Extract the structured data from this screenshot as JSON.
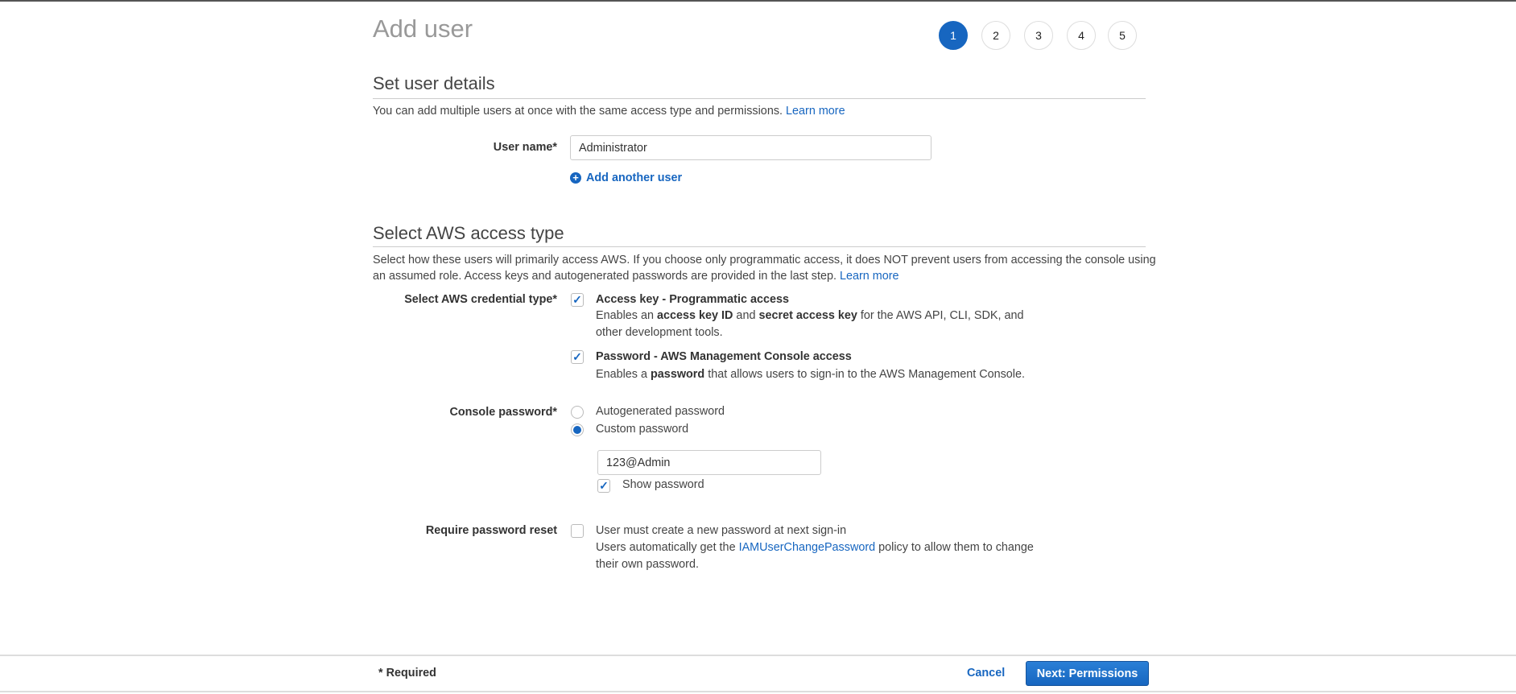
{
  "title": "Add user",
  "steps": [
    "1",
    "2",
    "3",
    "4",
    "5"
  ],
  "details": {
    "heading": "Set user details",
    "description": "You can add multiple users at once with the same access type and permissions.",
    "learn_more": "Learn more",
    "user_name_label": "User name*",
    "user_name_value": "Administrator",
    "add_another_user": "Add another user"
  },
  "access": {
    "heading": "Select AWS access type",
    "description_line1": "Select how these users will primarily access AWS. If you choose only programmatic access, it does NOT prevent users from accessing the console using",
    "description_line2": "an assumed role. Access keys and autogenerated passwords are provided in the last step.",
    "learn_more": "Learn more",
    "credential_label": "Select AWS credential type*",
    "programmatic": {
      "title": "Access key - Programmatic access",
      "d1": "Enables an ",
      "b1": "access key ID",
      "d2": " and ",
      "b2": "secret access key",
      "d3": " for the AWS API, CLI, SDK, and",
      "d4": "other development tools.",
      "checked": true
    },
    "console": {
      "title": "Password - AWS Management Console access",
      "d1": "Enables a ",
      "b1": "password",
      "d2": " that allows users to sign-in to the AWS Management Console.",
      "checked": true
    },
    "console_password_label": "Console password*",
    "autogenerated": "Autogenerated password",
    "custom": "Custom password",
    "password_value": "123@Admin",
    "show_password": "Show password",
    "reset_label": "Require password reset",
    "reset_text": "User must create a new password at next sign-in",
    "reset_d1": "Users automatically get the ",
    "reset_link": "IAMUserChangePassword",
    "reset_d2": " policy to allow them to change",
    "reset_d3": "their own password."
  },
  "footer": {
    "required": "* Required",
    "cancel": "Cancel",
    "next": "Next: Permissions"
  }
}
